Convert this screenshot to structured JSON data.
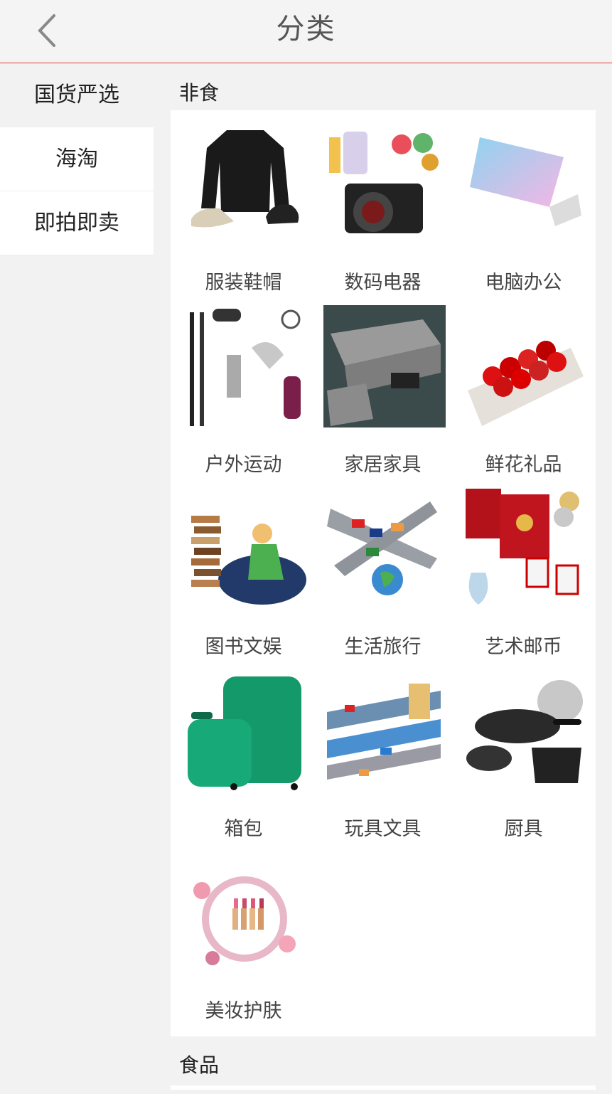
{
  "header": {
    "title": "分类",
    "back_icon": "chevron-left-icon"
  },
  "sidebar": {
    "items": [
      {
        "label": "国货严选",
        "active": true
      },
      {
        "label": "海淘",
        "active": false
      },
      {
        "label": "即拍即卖",
        "active": false
      }
    ]
  },
  "sections": [
    {
      "title": "非食",
      "categories": [
        {
          "label": "服装鞋帽",
          "icon": "clothing-shoes-hat-image"
        },
        {
          "label": "数码电器",
          "icon": "digital-electronics-image"
        },
        {
          "label": "电脑办公",
          "icon": "laptop-image"
        },
        {
          "label": "户外运动",
          "icon": "outdoor-sports-image"
        },
        {
          "label": "家居家具",
          "icon": "sofa-furniture-image"
        },
        {
          "label": "鲜花礼品",
          "icon": "roses-gift-box-image"
        },
        {
          "label": "图书文娱",
          "icon": "books-music-image"
        },
        {
          "label": "生活旅行",
          "icon": "airplane-travel-image"
        },
        {
          "label": "艺术邮币",
          "icon": "stamps-coins-image"
        },
        {
          "label": "箱包",
          "icon": "luggage-image"
        },
        {
          "label": "玩具文具",
          "icon": "toy-train-track-image"
        },
        {
          "label": "厨具",
          "icon": "cookware-pans-image"
        },
        {
          "label": "美妆护肤",
          "icon": "lipstick-cosmetics-image"
        }
      ]
    },
    {
      "title": "食品"
    }
  ],
  "colors": {
    "accent_line": "#e4393c",
    "background": "#f2f2f2",
    "panel": "#ffffff"
  }
}
